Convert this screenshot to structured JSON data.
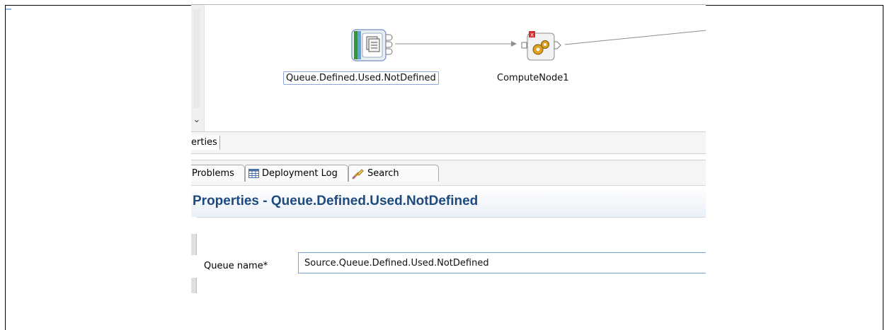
{
  "flow_canvas": {
    "nodes": [
      {
        "label": "Queue.Defined.Used.NotDefined",
        "type_icon": "mq-input-node-icon",
        "selected": true
      },
      {
        "label": "ComputeNode1",
        "type_icon": "compute-node-icon",
        "error_badge": true
      }
    ]
  },
  "view_tabs": {
    "properties_tab": "erties"
  },
  "bottom_tabs": [
    {
      "label": "Problems",
      "icon": "problems-icon"
    },
    {
      "label": "Deployment Log",
      "icon": "deployment-log-icon"
    },
    {
      "label": "Search",
      "icon": "search-icon"
    }
  ],
  "properties": {
    "title": "Properties - Queue.Defined.Used.NotDefined",
    "fields": [
      {
        "label": "Queue name*",
        "value": "Source.Queue.Defined.Used.NotDefined"
      }
    ]
  },
  "colors": {
    "title_blue": "#1f4a7e",
    "selection_border": "#8aa7d6",
    "input_border": "#7aa7d8"
  }
}
